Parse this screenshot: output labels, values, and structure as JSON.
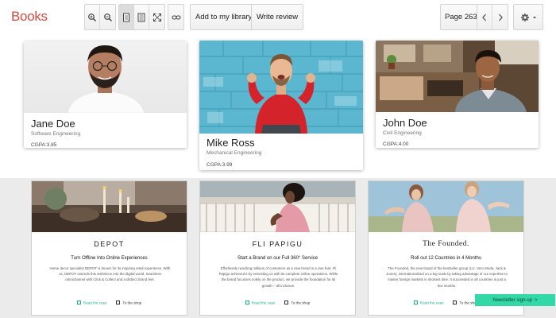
{
  "app_title": "Books",
  "toolbar": {
    "add_library_label": "Add to my library",
    "write_review_label": "Write review",
    "page_label": "Page 263"
  },
  "profiles": [
    {
      "name": "Jane Doe",
      "major": "Software Engineering",
      "gpa": "CGPA:3.85"
    },
    {
      "name": "Mike Ross",
      "major": "Mechanical Engineering",
      "gpa": "CGPA:3.99"
    },
    {
      "name": "John Doe",
      "major": "Civil Engineering",
      "gpa": "CGPA:4.00"
    }
  ],
  "cases": [
    {
      "brand": "DEPOT",
      "heading": "Turn Offline Into Online Experiences",
      "body": "Home decor specialist DEPOT is known for its inspiring retail experience. With us, DEPOT extends this ambience into the digital world. Seamless omnichannel with Click & Collect and a distinct brand feel.",
      "read_label": "Read the case",
      "shop_label": "To the shop"
    },
    {
      "brand": "FLI PAPIGU",
      "heading": "Start a Brand on our Full 360° Service",
      "body": "Effortlessly reaching millions of customers as a new brand is a rare feat. Fli Papigu achieved it by entrusting us with its complete online operations. While the brand focusses solely on the product, we provide the foundation for its growth – all inclusive.",
      "read_label": "Read the case",
      "shop_label": "To the shop"
    },
    {
      "brand": "The Founded.",
      "heading": "Roll out 12 Countries in 4 Months",
      "body": "The Founded, the new brand of the bestseller group (Liz, Vero Moda, Jack & Jones), internationalized on a big scale by taking advantage of our expertise to master foreign markets in shortest time. It succeeded in all countries in just a few months.",
      "read_label": "Read the case",
      "shop_label": "To the shop"
    }
  ],
  "newsletter_label": "Newsletter sign-up",
  "colors": {
    "logo": "#d54b3f",
    "accent": "#16b38a",
    "newsletter_bg": "#32d9a6"
  }
}
